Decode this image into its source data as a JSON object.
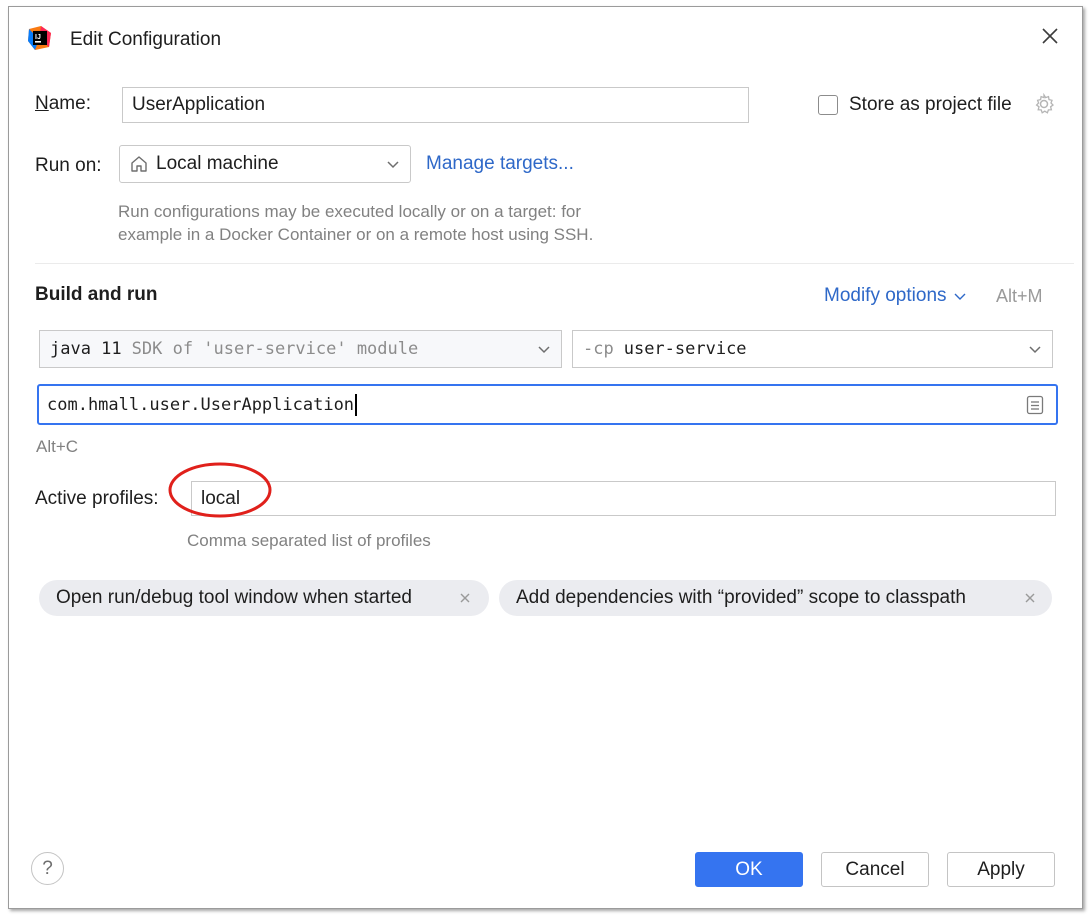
{
  "dialog": {
    "title": "Edit Configuration"
  },
  "name": {
    "label_prefix": "N",
    "label_rest": "ame:",
    "value": "UserApplication"
  },
  "store": {
    "label": "Store as project file"
  },
  "run_on": {
    "label": "Run on:",
    "value": "Local machine",
    "manage_link": "Manage targets...",
    "hint_line1": "Run configurations may be executed locally or on a target: for",
    "hint_line2": "example in a Docker Container or on a remote host using SSH."
  },
  "build": {
    "title": "Build and run",
    "modify_options": "Modify options",
    "modify_shortcut": "Alt+M"
  },
  "sdk": {
    "name": "java 11",
    "detail": "SDK of 'user-service' module"
  },
  "classpath": {
    "flag": "-cp",
    "module": "user-service"
  },
  "main_class": {
    "value": "com.hmall.user.UserApplication",
    "shortcut": "Alt+C"
  },
  "profiles": {
    "label": "Active profiles:",
    "value": "local",
    "hint": "Comma separated list of profiles"
  },
  "chips": [
    {
      "label": "Open run/debug tool window when started"
    },
    {
      "label": "Add dependencies with “provided” scope to classpath"
    }
  ],
  "buttons": {
    "ok": "OK",
    "cancel": "Cancel",
    "apply": "Apply",
    "help": "?"
  },
  "colors": {
    "accent": "#3574f0",
    "link": "#2e68c8",
    "annotation": "#e0201b"
  }
}
